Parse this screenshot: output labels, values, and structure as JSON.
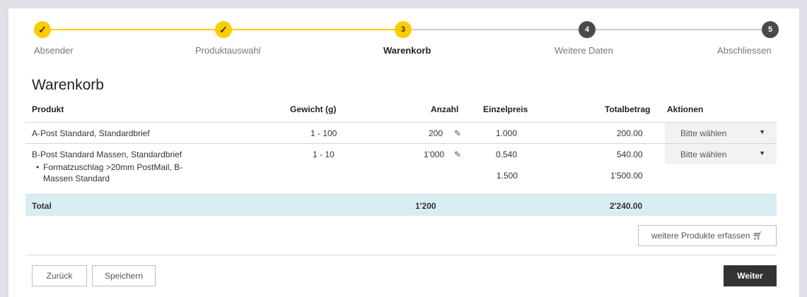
{
  "stepper": {
    "steps": [
      {
        "number": "✓",
        "label": "Absender",
        "state": "done"
      },
      {
        "number": "✓",
        "label": "Produktauswahl",
        "state": "done"
      },
      {
        "number": "3",
        "label": "Warenkorb",
        "state": "active"
      },
      {
        "number": "4",
        "label": "Weitere Daten",
        "state": "todo"
      },
      {
        "number": "5",
        "label": "Abschliessen",
        "state": "todo"
      }
    ]
  },
  "page_title": "Warenkorb",
  "table": {
    "headers": {
      "product": "Produkt",
      "weight": "Gewicht (g)",
      "quantity": "Anzahl",
      "unit_price": "Einzelpreis",
      "total": "Totalbetrag",
      "actions": "Aktionen"
    },
    "rows": [
      {
        "product": "A-Post Standard, Standardbrief",
        "weight": "1 - 100",
        "quantity": "200",
        "unit_price": "1.000",
        "total": "200.00",
        "action": "Bitte wählen"
      },
      {
        "product": "B-Post Standard Massen, Standardbrief",
        "weight": "1 - 10",
        "quantity": "1'000",
        "unit_price": "0.540",
        "total": "540.00",
        "action": "Bitte wählen",
        "surcharge": {
          "label_line1": "Formatzuschlag >20mm PostMail, B-",
          "label_line2": "Massen Standard",
          "unit_price": "1.500",
          "total": "1'500.00"
        }
      }
    ],
    "total_row": {
      "label": "Total",
      "quantity": "1'200",
      "total": "2'240.00"
    }
  },
  "buttons": {
    "add_products": "weitere Produkte erfassen",
    "back": "Zurück",
    "save": "Speichern",
    "next": "Weiter"
  },
  "colors": {
    "accent_yellow": "#ffcc00",
    "total_row_bg": "#d8edf2",
    "primary_button": "#333333"
  }
}
